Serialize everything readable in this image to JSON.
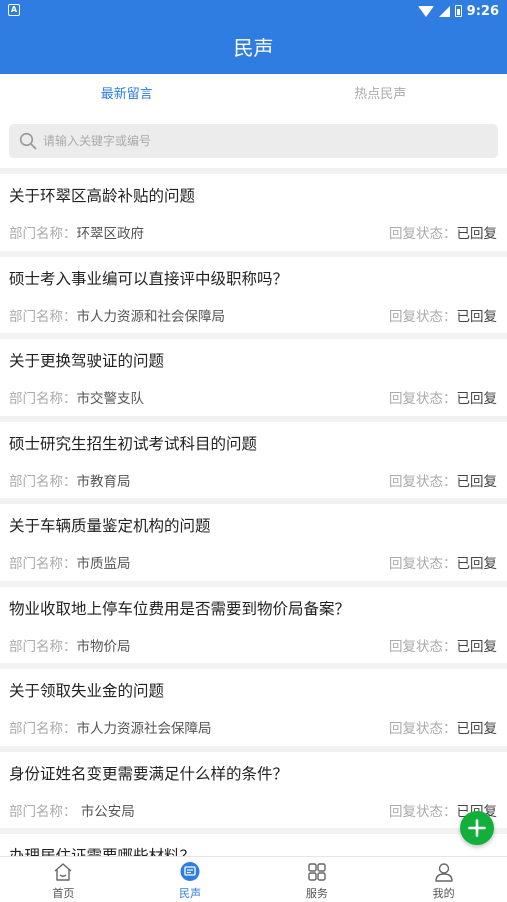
{
  "status_bar": {
    "time": "9:26",
    "left_icon": "A"
  },
  "app_bar": {
    "title": "民声"
  },
  "tabs": [
    {
      "label": "最新留言",
      "active": true
    },
    {
      "label": "热点民声",
      "active": false
    }
  ],
  "search": {
    "placeholder": "请输入关键字或编号",
    "value": ""
  },
  "list": {
    "dept_label": "部门名称：",
    "status_label": "回复状态：",
    "items": [
      {
        "title": "关于环翠区高龄补贴的问题",
        "dept": "环翠区政府",
        "status": "已回复"
      },
      {
        "title": "硕士考入事业编可以直接评中级职称吗？",
        "dept": "市人力资源和社会保障局",
        "status": "已回复"
      },
      {
        "title": "关于更换驾驶证的问题",
        "dept": "市交警支队",
        "status": "已回复"
      },
      {
        "title": "硕士研究生招生初试考试科目的问题",
        "dept": "市教育局",
        "status": "已回复"
      },
      {
        "title": "关于车辆质量鉴定机构的问题",
        "dept": "市质监局",
        "status": "已回复"
      },
      {
        "title": "物业收取地上停车位费用是否需要到物价局备案？",
        "dept": "市物价局",
        "status": "已回复"
      },
      {
        "title": "关于领取失业金的问题",
        "dept": "市人力资源社会保障局",
        "status": "已回复"
      },
      {
        "title": "身份证姓名变更需要满足什么样的条件？",
        "dept": " 市公安局",
        "status": "已回复"
      },
      {
        "title": "办理居住证需要哪些材料？",
        "dept": "",
        "status": ""
      }
    ]
  },
  "fab": {
    "icon": "plus-icon",
    "color": "#10b03a"
  },
  "bottom_nav": [
    {
      "label": "首页",
      "icon": "home-icon",
      "active": false
    },
    {
      "label": "民声",
      "icon": "message-icon",
      "active": true
    },
    {
      "label": "服务",
      "icon": "grid-icon",
      "active": false
    },
    {
      "label": "我的",
      "icon": "user-icon",
      "active": false
    }
  ],
  "colors": {
    "primary": "#2f7de1",
    "background": "#f2f2f2"
  }
}
